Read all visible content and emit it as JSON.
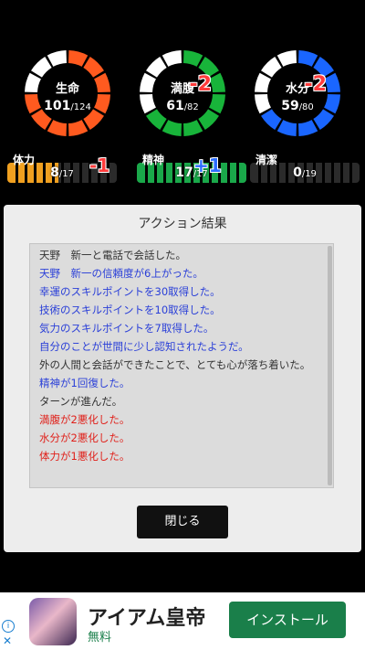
{
  "gauges": [
    {
      "label": "生命",
      "current": "101",
      "max": "/124",
      "ratio": 0.81,
      "color": "#ff5a1f",
      "delta": ""
    },
    {
      "label": "満腹",
      "current": "61",
      "max": "/82",
      "ratio": 0.74,
      "color": "#18b43a",
      "delta": "-2"
    },
    {
      "label": "水分",
      "current": "59",
      "max": "/80",
      "ratio": 0.74,
      "color": "#1a66ff",
      "delta": "-2"
    }
  ],
  "stats": [
    {
      "label": "体力",
      "current": "8",
      "max": "/17",
      "ratio": 0.47,
      "color": "#f0a020",
      "delta": "-1",
      "delta_color": "#ff3b3b"
    },
    {
      "label": "精神",
      "current": "17",
      "max": "/17",
      "ratio": 1.0,
      "color": "#1aa84a",
      "delta": "+1",
      "delta_color": "#2a6bff"
    },
    {
      "label": "清潔",
      "current": "0",
      "max": "/19",
      "ratio": 0.0,
      "color": "#9a9a9a",
      "delta": "",
      "delta_color": "#ff3b3b"
    }
  ],
  "panel": {
    "title": "アクション結果",
    "close_label": "閉じる",
    "log": [
      {
        "text": "天野　新一と電話で会話した。",
        "color": "#333333"
      },
      {
        "text": "天野　新一の信頼度が6上がった。",
        "color": "#2a3fd8"
      },
      {
        "text": "幸運のスキルポイントを30取得した。",
        "color": "#2a3fd8"
      },
      {
        "text": "技術のスキルポイントを10取得した。",
        "color": "#2a3fd8"
      },
      {
        "text": "気力のスキルポイントを7取得した。",
        "color": "#2a3fd8"
      },
      {
        "text": "自分のことが世間に少し認知されたようだ。",
        "color": "#2a3fd8"
      },
      {
        "text": "外の人間と会話ができたことで、とても心が落ち着いた。",
        "color": "#333333"
      },
      {
        "text": "精神が1回復した。",
        "color": "#2a3fd8"
      },
      {
        "text": "ターンが進んだ。",
        "color": "#333333"
      },
      {
        "text": "満腹が2悪化した。",
        "color": "#e0201a"
      },
      {
        "text": "水分が2悪化した。",
        "color": "#e0201a"
      },
      {
        "text": "体力が1悪化した。",
        "color": "#e0201a"
      }
    ]
  },
  "ad": {
    "title": "アイアム皇帝",
    "subtitle": "無料",
    "install_label": "インストール",
    "info_icon": "i",
    "close_icon": "✕"
  }
}
